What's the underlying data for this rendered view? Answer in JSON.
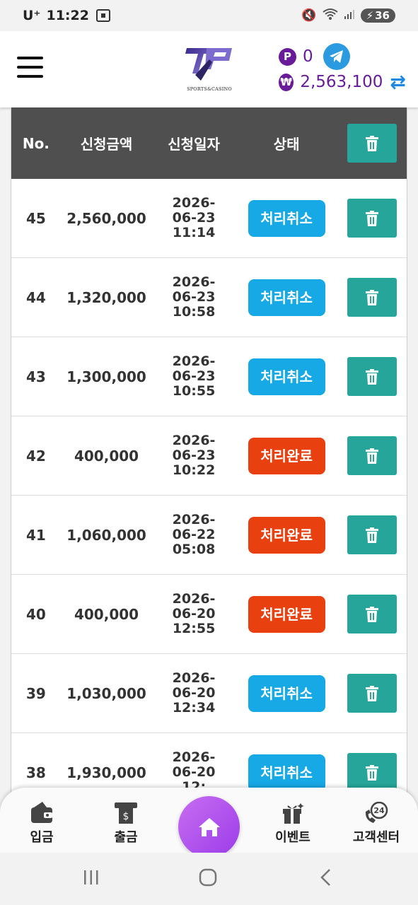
{
  "status_bar": {
    "carrier": "U⁺",
    "time": "11:22",
    "battery": "36"
  },
  "header": {
    "logo_text": "SPORTS&CASINO",
    "point_symbol": "P",
    "point_value": "0",
    "won_symbol": "₩",
    "cash_value": "2,563,100"
  },
  "table": {
    "headers": {
      "no": "No.",
      "amount": "신청금액",
      "date": "신청일자",
      "status": "상태"
    },
    "rows": [
      {
        "no": "45",
        "amount": "2,560,000",
        "date": "2026-",
        "date2": "06-23",
        "time": "11:14",
        "status": "처리취소"
      },
      {
        "no": "44",
        "amount": "1,320,000",
        "date": "2026-",
        "date2": "06-23",
        "time": "10:58",
        "status": "처리취소"
      },
      {
        "no": "43",
        "amount": "1,300,000",
        "date": "2026-",
        "date2": "06-23",
        "time": "10:55",
        "status": "처리취소"
      },
      {
        "no": "42",
        "amount": "400,000",
        "date": "2026-",
        "date2": "06-23",
        "time": "10:22",
        "status": "처리완료"
      },
      {
        "no": "41",
        "amount": "1,060,000",
        "date": "2026-",
        "date2": "06-22",
        "time": "05:08",
        "status": "처리완료"
      },
      {
        "no": "40",
        "amount": "400,000",
        "date": "2026-",
        "date2": "06-20",
        "time": "12:55",
        "status": "처리완료"
      },
      {
        "no": "39",
        "amount": "1,030,000",
        "date": "2026-",
        "date2": "06-20",
        "time": "12:34",
        "status": "처리취소"
      },
      {
        "no": "38",
        "amount": "1,930,000",
        "date": "2026-",
        "date2": "06-20",
        "time": "12:",
        "status": "처리취소"
      }
    ]
  },
  "colors": {
    "cancelled": "#17a8e6",
    "completed": "#e8400f",
    "delete": "#26a69a",
    "header_bg": "#4f4f4f",
    "accent": "#6a1b9a"
  },
  "bottom_nav": {
    "deposit": "입금",
    "withdraw": "출금",
    "event": "이벤트",
    "support": "고객센터",
    "support_badge": "24"
  }
}
